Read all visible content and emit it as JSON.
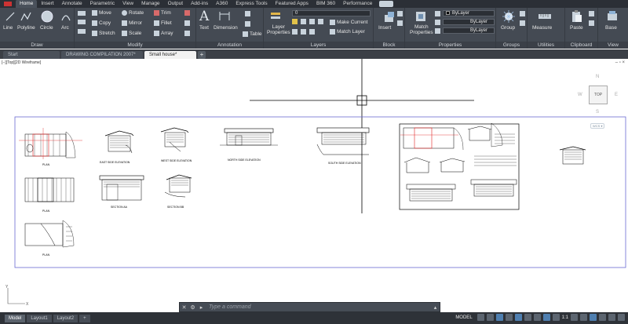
{
  "ribbon_tabs": [
    "Home",
    "Insert",
    "Annotate",
    "Parametric",
    "View",
    "Manage",
    "Output",
    "Add-ins",
    "A360",
    "Express Tools",
    "Featured Apps",
    "BIM 360",
    "Performance"
  ],
  "panels": {
    "draw": {
      "title": "Draw",
      "line": "Line",
      "polyline": "Polyline",
      "circle": "Circle",
      "arc": "Arc"
    },
    "modify": {
      "title": "Modify",
      "move": "Move",
      "rotate": "Rotate",
      "trim": "Trim",
      "copy": "Copy",
      "mirror": "Mirror",
      "fillet": "Fillet",
      "stretch": "Stretch",
      "scale": "Scale",
      "array": "Array"
    },
    "annotation": {
      "title": "Annotation",
      "text": "Text",
      "dimension": "Dimension",
      "table": "Table"
    },
    "layers": {
      "title": "Layers",
      "layer_properties": "Layer\nProperties",
      "current_layer": "0",
      "make_current": "Make Current",
      "match_layer": "Match Layer"
    },
    "block": {
      "title": "Block",
      "insert": "Insert"
    },
    "properties": {
      "title": "Properties",
      "match_properties": "Match\nProperties",
      "color": "ByLayer",
      "linetype": "ByLayer",
      "lineweight": "ByLayer"
    },
    "groups": {
      "title": "Groups",
      "group": "Group"
    },
    "utilities": {
      "title": "Utilities",
      "measure": "Measure"
    },
    "clipboard": {
      "title": "Clipboard",
      "paste": "Paste"
    },
    "view": {
      "title": "View",
      "base": "Base"
    }
  },
  "file_tabs": [
    "Start",
    "DRAWING COMPILATION 2007*",
    "Small house*"
  ],
  "viewport_label": "[−][Top][2D Wireframe]",
  "viewcube": {
    "top": "TOP",
    "n": "N",
    "s": "S",
    "e": "E",
    "w": "W",
    "wcs": "WCS ▾"
  },
  "drawing_labels": {
    "plan1": "PLAN",
    "plan2": "PLAN",
    "plan3": "PLAN",
    "east": "EAST SIDE ELEVATION",
    "west": "WEST SIDE ELEVATION",
    "north": "NORTH SIDE ELEVATION",
    "south": "SOUTH SIDE ELEVATION",
    "section_aa": "SECTION AA",
    "section_bb": "SECTION BB"
  },
  "command_line": {
    "placeholder": "Type a command"
  },
  "status_bar": {
    "tabs": [
      "Model",
      "Layout1",
      "Layout2"
    ],
    "active_tab": "Model",
    "model": "MODEL",
    "scale": "1:1"
  }
}
